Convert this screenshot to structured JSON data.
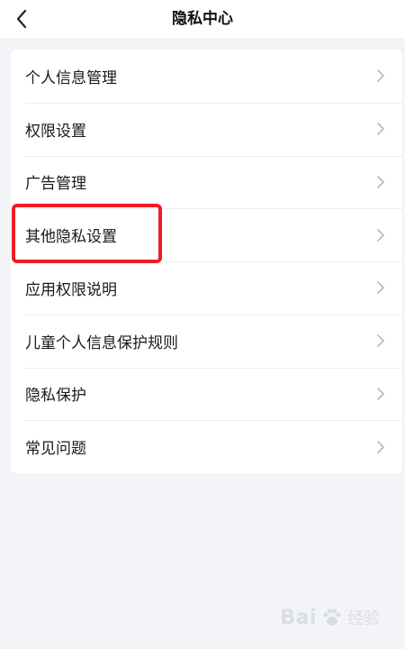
{
  "header": {
    "title": "隐私中心"
  },
  "menu": {
    "items": [
      {
        "label": "个人信息管理"
      },
      {
        "label": "权限设置"
      },
      {
        "label": "广告管理"
      },
      {
        "label": "其他隐私设置"
      },
      {
        "label": "应用权限说明"
      },
      {
        "label": "儿童个人信息保护规则"
      },
      {
        "label": "隐私保护"
      },
      {
        "label": "常见问题"
      }
    ]
  },
  "annotation": {
    "highlight_color": "#ee1c25",
    "highlighted_item": "其他隐私设置"
  },
  "watermark": {
    "text_left": "Bai",
    "text_right": "经验"
  },
  "colors": {
    "background": "#f2f4f8",
    "card": "#ffffff",
    "chevron": "#b8b8be"
  }
}
